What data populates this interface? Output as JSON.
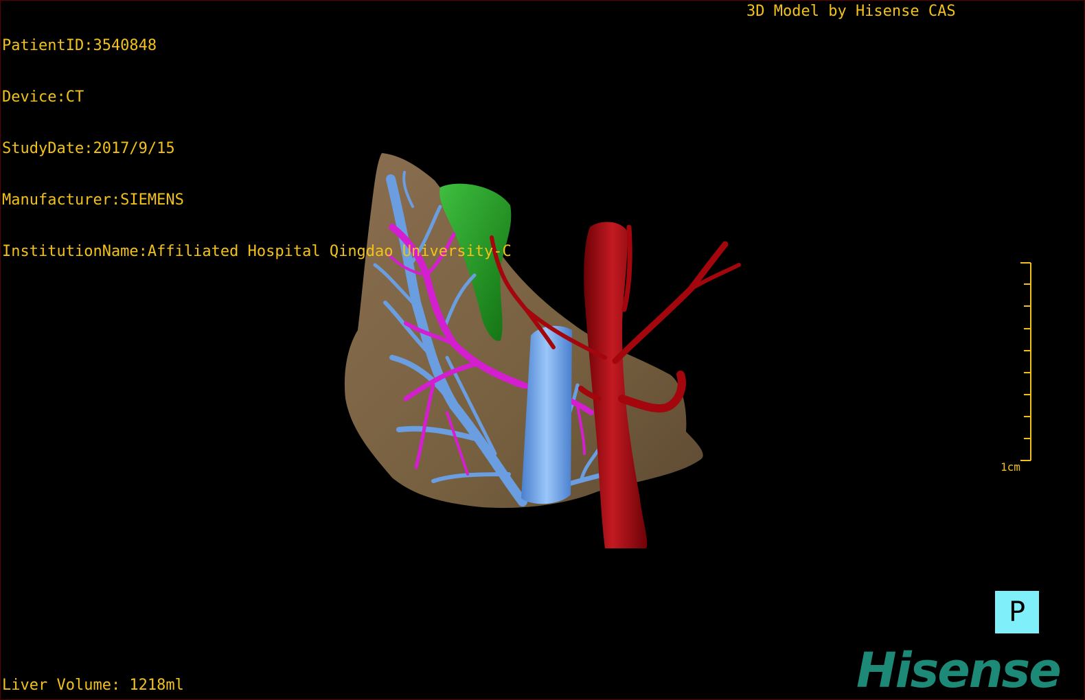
{
  "info": {
    "patient_id": "PatientID:3540848",
    "device": "Device:CT",
    "study_date": "StudyDate:2017/9/15",
    "manufacturer": "Manufacturer:SIEMENS",
    "institution": "InstitutionName:Affiliated Hospital Qingdao University-C"
  },
  "credit": "3D Model by Hisense CAS",
  "liver_volume": "Liver Volume: 1218ml",
  "scale_bar": {
    "label": "1cm"
  },
  "orientation": {
    "label": "P"
  },
  "brand": "Hisense",
  "colors": {
    "overlay_text": "#f2c21b",
    "liver": "#7a6145",
    "portal_vein": "#6a9ee0",
    "hepatic_artery": "#d31fd0",
    "gallbladder": "#1f9a1f",
    "aorta": "#a3060d",
    "vena_cava": "#7fb2ee",
    "orientation_box": "#7ff0fa",
    "brand": "#1d8a78"
  }
}
